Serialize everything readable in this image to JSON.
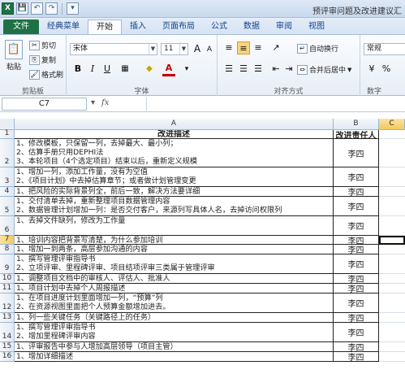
{
  "titlebar": {
    "title": "预评审问题及改进建议汇"
  },
  "qat": {
    "save": "💾",
    "undo": "↶",
    "redo": "↷"
  },
  "tabs": [
    "文件",
    "经典菜单",
    "开始",
    "插入",
    "页面布局",
    "公式",
    "数据",
    "审阅",
    "视图"
  ],
  "ribbon": {
    "clipboard": {
      "paste": "粘贴",
      "cut": "剪切",
      "copy": "复制",
      "format_painter": "格式刷",
      "group": "剪贴板"
    },
    "font": {
      "name": "宋体",
      "size": "11",
      "bold": "B",
      "italic": "I",
      "underline": "U",
      "grow": "A",
      "shrink": "A",
      "color": "A",
      "group": "字体"
    },
    "alignment": {
      "wrap": "自动换行",
      "merge": "合并后居中",
      "group": "对齐方式"
    },
    "number": {
      "format": "常规",
      "group": "数字"
    }
  },
  "formula_bar": {
    "name_box": "C7",
    "fx": "fx",
    "value": ""
  },
  "columns": [
    {
      "label": "A"
    },
    {
      "label": "B"
    },
    {
      "label": "C"
    }
  ],
  "rows": [
    {
      "num": "1",
      "a": "改进描述",
      "b": "改进责任人",
      "header": true
    },
    {
      "num": "2",
      "a": "1、修改模板，只保留一列，去掉最大、最小列；\n2、估算手册只用DEPHI法\n3、本轮项目（4个选定项目）结束以后，重新定义规模",
      "b": "李四"
    },
    {
      "num": "3",
      "a": "1、增加一列，添加工作量，没有为空值\n2、《项目计划》中去掉估算章节；或者做计划管理变更",
      "b": "李四"
    },
    {
      "num": "4",
      "a": "1、把风险的实际背景列全，前后一致，解决方法要详细",
      "b": "李四"
    },
    {
      "num": "5",
      "a": "1、交付清单去掉，重新整理项目数据管理内容\n2、数据管理计划增加一列：是否交付客户，来源列写具体人名，去掉访问权限列",
      "b": "李四"
    },
    {
      "num": "6",
      "a": "1、去掉文件缺列，修改为工作量",
      "b": "李四"
    },
    {
      "num": "7",
      "a": "1、培训内容把背景写清楚，为什么参加培训",
      "b": "李四"
    },
    {
      "num": "8",
      "a": "1、增加一到两条，高层参加沟通的内容",
      "b": "李四"
    },
    {
      "num": "9",
      "a": "1、撰写管理评审指导书\n2、立项评审、里程碑评审、项目结项评审三类属于管理评审",
      "b": "李四"
    },
    {
      "num": "10",
      "a": "1、调整项目文档中的审核人、评估人、批准人",
      "b": "李四"
    },
    {
      "num": "11",
      "a": "1、项目计划中去掉个人周报描述",
      "b": "李四"
    },
    {
      "num": "12",
      "a": "1、在项目进度计划里面增加一列，“预算”列\n2、在资源视图里面把个人预算金额增加进去。",
      "b": "李四"
    },
    {
      "num": "13",
      "a": "1、列一些关键任务（关键路径上的任务）",
      "b": "李四"
    },
    {
      "num": "14",
      "a": "1、撰写管理评审指导书\n2、增加里程碑评审内容",
      "b": "李四"
    },
    {
      "num": "15",
      "a": "1、评审报告中参与人增加高层领导（项目主管）",
      "b": "李四"
    },
    {
      "num": "16",
      "a": "1、增加详细描述",
      "b": "李四"
    }
  ]
}
